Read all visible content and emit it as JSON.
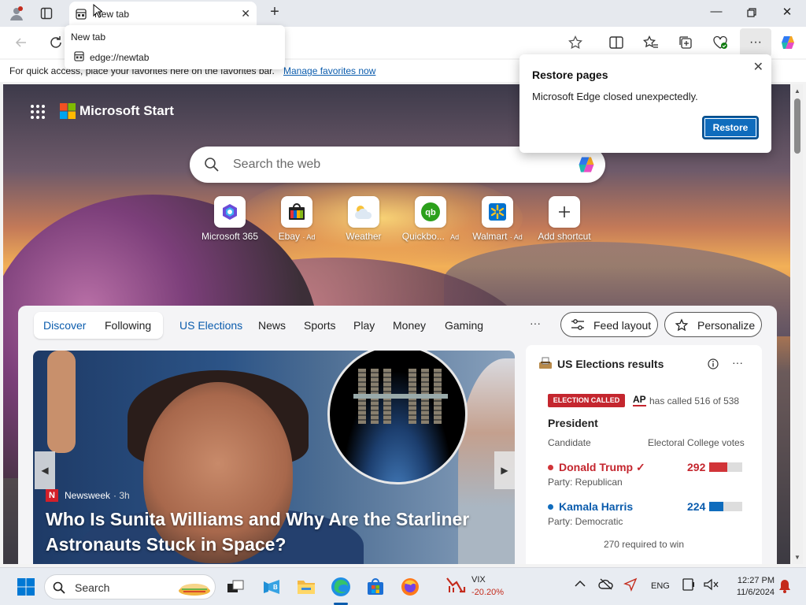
{
  "browser": {
    "tab_title": "New tab",
    "tooltip": {
      "title": "New tab",
      "url": "edge://newtab"
    },
    "favorites_bar": {
      "text": "For quick access, place your favorites here on the favorites bar.",
      "link": "Manage favorites now"
    }
  },
  "restore_popup": {
    "title": "Restore pages",
    "message": "Microsoft Edge closed unexpectedly.",
    "button": "Restore"
  },
  "start_page": {
    "brand": "Microsoft Start",
    "search_placeholder": "Search the web",
    "shortcuts": [
      {
        "label": "Microsoft 365",
        "ad": "",
        "icon": "microsoft365-icon"
      },
      {
        "label": "Ebay",
        "ad": "· Ad",
        "icon": "ebay-icon"
      },
      {
        "label": "Weather",
        "ad": "",
        "icon": "weather-icon"
      },
      {
        "label": "Quickbo...",
        "ad": "Ad",
        "icon": "quickbooks-icon"
      },
      {
        "label": "Walmart",
        "ad": "· Ad",
        "icon": "walmart-icon"
      },
      {
        "label": "Add shortcut",
        "ad": "",
        "icon": "plus-icon"
      }
    ]
  },
  "feed": {
    "pill": {
      "discover": "Discover",
      "following": "Following"
    },
    "tabs": [
      "US Elections",
      "News",
      "Sports",
      "Play",
      "Money",
      "Gaming"
    ],
    "more": "···",
    "feed_layout": "Feed layout",
    "personalize": "Personalize",
    "hero": {
      "source": "Newsweek",
      "time": "· 3h",
      "headline": "Who Is Sunita Williams and Why Are the Starliner Astronauts Stuck in Space?"
    },
    "election": {
      "title": "US Elections results",
      "called_badge": "ELECTION CALLED",
      "ap": "AP",
      "called_text": "has called 516 of 538",
      "race": "President",
      "col_candidate": "Candidate",
      "col_votes": "Electoral College votes",
      "candidates": [
        {
          "name": "Donald Trump",
          "check": "✓",
          "party": "Party: Republican",
          "votes": "292",
          "color": "#d13438",
          "share": 0.54
        },
        {
          "name": "Kamala Harris",
          "check": "",
          "party": "Party: Democratic",
          "votes": "224",
          "color": "#0f6cbd",
          "share": 0.42
        }
      ],
      "required": "270 required to win"
    }
  },
  "taskbar": {
    "search_label": "Search",
    "vix": {
      "name": "VIX",
      "change": "-20.20%"
    },
    "lang": "ENG",
    "time": "12:27 PM",
    "date": "11/6/2024"
  },
  "colors": {
    "accent": "#0f6cbd",
    "link": "#0b5cad",
    "republican": "#d13438",
    "democratic": "#0f6cbd",
    "called_red": "#c4262e"
  }
}
